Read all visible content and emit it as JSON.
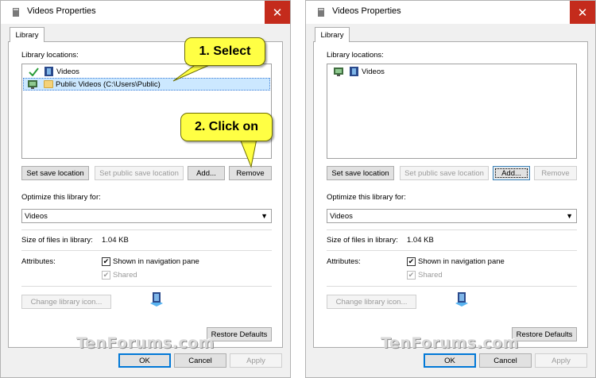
{
  "left_window": {
    "title": "Videos Properties",
    "tab": "Library",
    "locations_label": "Library locations:",
    "locations": [
      {
        "label": "Videos",
        "status": "check-icon"
      },
      {
        "label": "Public Videos (C:\\Users\\Public)",
        "status": "network-icon",
        "selected": true
      }
    ],
    "buttons": {
      "set_save": "Set save location",
      "set_public": "Set public save location",
      "add": "Add...",
      "remove": "Remove"
    },
    "optimize_label": "Optimize this library for:",
    "optimize_value": "Videos",
    "size_label": "Size of files in library:",
    "size_value": "1.04 KB",
    "attributes_label": "Attributes:",
    "shown_in_nav": "Shown in navigation pane",
    "shared": "Shared",
    "change_icon": "Change library icon...",
    "restore": "Restore Defaults",
    "ok": "OK",
    "cancel": "Cancel",
    "apply": "Apply"
  },
  "right_window": {
    "title": "Videos Properties",
    "tab": "Library",
    "locations_label": "Library locations:",
    "locations": [
      {
        "label": "Videos",
        "status": "network-icon"
      }
    ],
    "buttons": {
      "set_save": "Set save location",
      "set_public": "Set public save location",
      "add": "Add...",
      "remove": "Remove"
    },
    "optimize_label": "Optimize this library for:",
    "optimize_value": "Videos",
    "size_label": "Size of files in library:",
    "size_value": "1.04 KB",
    "attributes_label": "Attributes:",
    "shown_in_nav": "Shown in navigation pane",
    "shared": "Shared",
    "change_icon": "Change library icon...",
    "restore": "Restore Defaults",
    "ok": "OK",
    "cancel": "Cancel",
    "apply": "Apply"
  },
  "callouts": {
    "select": "1. Select",
    "click_on": "2. Click on"
  },
  "watermark": "TenForums.com",
  "colors": {
    "close_button": "#c42b1c",
    "callout": "#ffff44",
    "selection": "#cce8ff"
  }
}
